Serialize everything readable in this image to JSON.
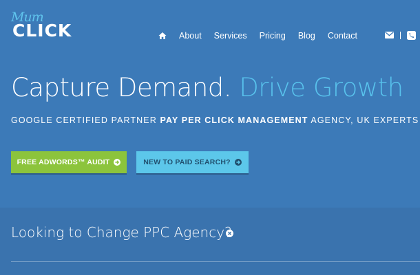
{
  "logo": {
    "script_text": "Mum",
    "word": "CLICK"
  },
  "nav": {
    "home_icon": "home-icon",
    "items": [
      {
        "label": "About"
      },
      {
        "label": "Services"
      },
      {
        "label": "Pricing"
      },
      {
        "label": "Blog"
      },
      {
        "label": "Contact"
      }
    ]
  },
  "contact_icons": {
    "email": "envelope-icon",
    "divider": "|",
    "phone": "phone-icon"
  },
  "hero": {
    "title_main": "Capture Demand.",
    "title_accent": "Drive Growth",
    "subtitle_pre": "GOOGLE CERTIFIED PARTNER ",
    "subtitle_bold": "PAY PER CLICK MANAGEMENT",
    "subtitle_post": " AGENCY, UK EXPERTS"
  },
  "buttons": {
    "audit_label": "FREE ADWORDS™ AUDIT",
    "new_label": "NEW TO PAID SEARCH?",
    "arrow_icon": "circle-arrow-right-icon"
  },
  "band": {
    "title": "Looking to Change PPC Agency?",
    "close_icon": "close-icon"
  },
  "colors": {
    "background": "#3c7ab8",
    "accent": "#58c2ec",
    "audit_button": "#8cc43c",
    "new_button": "#5cc7ea",
    "band": "#3a73ae"
  }
}
